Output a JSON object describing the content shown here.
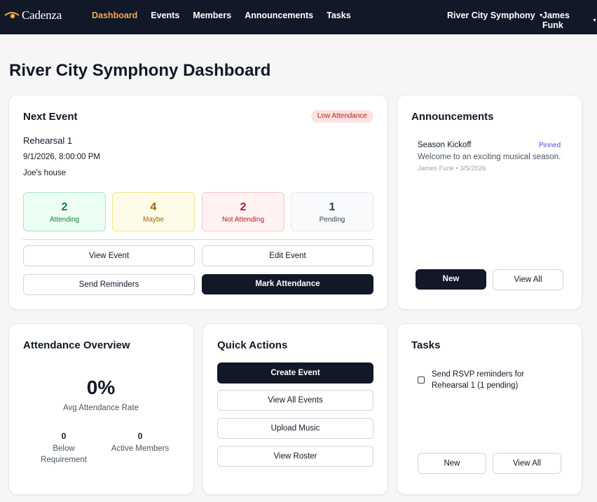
{
  "nav": {
    "brand": "Cadenza",
    "brand_icon": "eye-icon",
    "brand_color": "#f5a84a",
    "links": [
      "Dashboard",
      "Events",
      "Members",
      "Announcements",
      "Tasks"
    ],
    "active": "Dashboard",
    "org_selector": "River City Symphony",
    "user_menu": "James Funk"
  },
  "page": {
    "title": "River City Symphony Dashboard"
  },
  "next_event": {
    "title": "Next Event",
    "badge": "Low Attendance",
    "name": "Rehearsal 1",
    "datetime": "9/1/2026, 8:00:00 PM",
    "location": "Joe's house",
    "stats": {
      "attending": {
        "value": "2",
        "label": "Attending"
      },
      "maybe": {
        "value": "4",
        "label": "Maybe"
      },
      "not_attending": {
        "value": "2",
        "label": "Not Attending"
      },
      "pending": {
        "value": "1",
        "label": "Pending"
      }
    },
    "buttons": {
      "view": "View Event",
      "edit": "Edit Event",
      "remind": "Send Reminders",
      "mark": "Mark Attendance"
    }
  },
  "announcements": {
    "title": "Announcements",
    "item": {
      "title": "Season Kickoff",
      "pinned": "Pinned",
      "body": "Welcome to an exciting musical season.",
      "meta": "James Funk • 3/5/2026"
    },
    "new_label": "New",
    "view_all_label": "View All"
  },
  "attendance": {
    "title": "Attendance Overview",
    "rate": "0%",
    "rate_label": "Avg Attendance Rate",
    "below": {
      "value": "0",
      "label": "Below Requirement"
    },
    "active": {
      "value": "0",
      "label": "Active Members"
    }
  },
  "quick_actions": {
    "title": "Quick Actions",
    "create": "Create Event",
    "view_events": "View All Events",
    "upload": "Upload Music",
    "roster": "View Roster"
  },
  "tasks": {
    "title": "Tasks",
    "item": "Send RSVP reminders for Rehearsal 1 (1 pending)",
    "new_label": "New",
    "view_all_label": "View All"
  }
}
